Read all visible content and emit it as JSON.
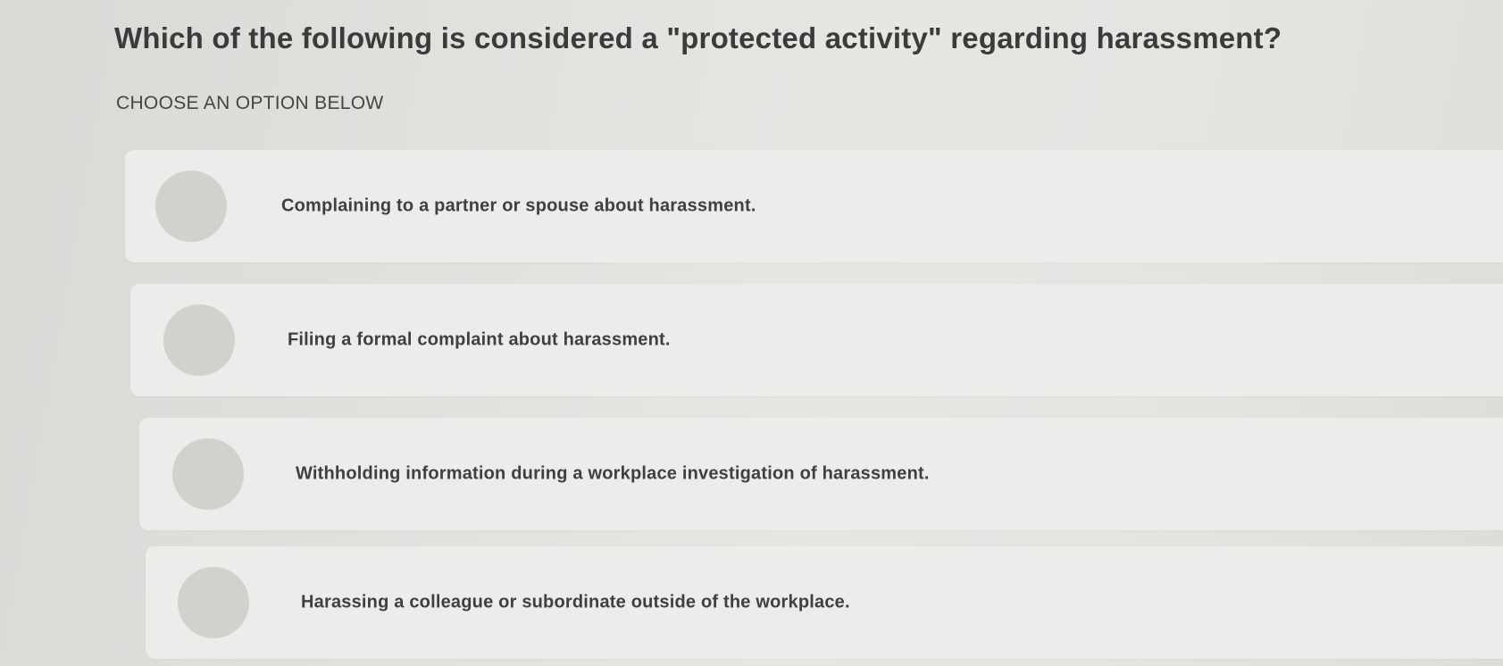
{
  "question": {
    "text": "Which of the following is considered a \"protected activity\" regarding harassment?"
  },
  "prompt": {
    "text": "CHOOSE AN OPTION BELOW"
  },
  "options": [
    {
      "label": "Complaining to a partner or spouse about harassment.",
      "selected": false
    },
    {
      "label": "Filing a formal complaint about harassment.",
      "selected": false
    },
    {
      "label": "Withholding information during a workplace investigation of harassment.",
      "selected": false
    },
    {
      "label": "Harassing a colleague or subordinate outside of the workplace.",
      "selected": false
    }
  ],
  "colors": {
    "card_background": "#ececea",
    "radio_fill": "#d3d1cd",
    "text": "#3b3b3b"
  }
}
